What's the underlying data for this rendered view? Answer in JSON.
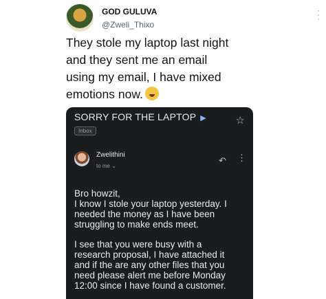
{
  "tweet": {
    "author_name": "GOD GULUVA",
    "author_handle": "@Zweli_Thixo",
    "text_lines": [
      "They stole my laptop last night",
      "and they sent me an email",
      "using my email, I have mixed",
      "emotions now."
    ],
    "emoji_icon": "weary-face-icon"
  },
  "email": {
    "subject": "SORRY FOR THE LAPTOP",
    "label_chip": "Inbox",
    "sender_name": "Zwelithini",
    "recipient": "to me",
    "body_paragraphs": [
      [
        "Bro howzit,",
        "I know I stole your laptop yesterday. I",
        "needed the money as I have been",
        "struggling to make ends meet."
      ],
      [
        "I see that you were busy with a",
        "research proposal, I have attached it",
        "and if the are any other files that you",
        "need please alert me before Monday",
        "12:00 since I have found a customer."
      ]
    ]
  },
  "colors": {
    "card_background": "#1b1c1e",
    "text_primary": "#0f1419",
    "handle_grey": "#536471",
    "email_text": "#e8eaed",
    "accent_arrow": "#8ab4f8"
  }
}
